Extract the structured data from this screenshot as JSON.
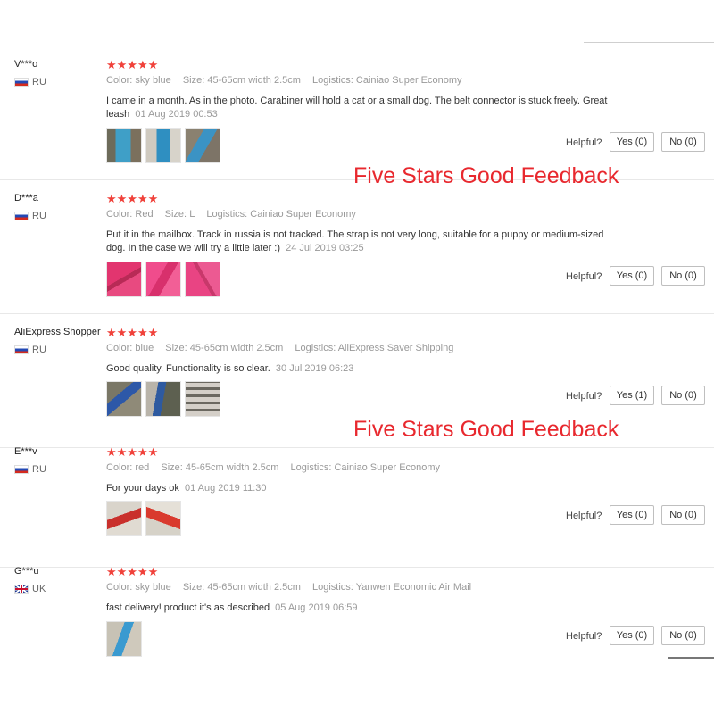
{
  "banner_text": "Five Stars Good Feedback",
  "helpful_label": "Helpful?",
  "reviews": [
    {
      "user": "V***o",
      "country": "RU",
      "stars": "★★★★★",
      "color_label": "Color:",
      "color": "sky blue",
      "size_label": "Size:",
      "size": "45-65cm width 2.5cm",
      "logistics_label": "Logistics:",
      "logistics": "Cainiao Super Economy",
      "text": "I came in a month. As in the photo. Carabiner will hold a cat or a small dog. The belt connector is stuck freely. Great leash",
      "date": "01 Aug 2019 00:53",
      "yes": "Yes (0)",
      "no": "No (0)"
    },
    {
      "user": "D***a",
      "country": "RU",
      "stars": "★★★★★",
      "color_label": "Color:",
      "color": "Red",
      "size_label": "Size:",
      "size": "L",
      "logistics_label": "Logistics:",
      "logistics": "Cainiao Super Economy",
      "text": "Put it in the mailbox. Track in russia is not tracked. The strap is not very long, suitable for a puppy or medium-sized dog. In the case we will try a little later :)",
      "date": "24 Jul 2019 03:25",
      "yes": "Yes (0)",
      "no": "No (0)"
    },
    {
      "user": "AliExpress Shopper",
      "country": "RU",
      "stars": "★★★★★",
      "color_label": "Color:",
      "color": "blue",
      "size_label": "Size:",
      "size": "45-65cm width 2.5cm",
      "logistics_label": "Logistics:",
      "logistics": "AliExpress Saver Shipping",
      "text": "Good quality. Functionality is so clear.",
      "date": "30 Jul 2019 06:23",
      "yes": "Yes (1)",
      "no": "No (0)"
    },
    {
      "user": "E***v",
      "country": "RU",
      "stars": "★★★★★",
      "color_label": "Color:",
      "color": "red",
      "size_label": "Size:",
      "size": "45-65cm width 2.5cm",
      "logistics_label": "Logistics:",
      "logistics": "Cainiao Super Economy",
      "text": "For your days ok",
      "date": "01 Aug 2019 11:30",
      "yes": "Yes (0)",
      "no": "No (0)"
    },
    {
      "user": "G***u",
      "country": "UK",
      "stars": "★★★★★",
      "color_label": "Color:",
      "color": "sky blue",
      "size_label": "Size:",
      "size": "45-65cm width 2.5cm",
      "logistics_label": "Logistics:",
      "logistics": "Yanwen Economic Air Mail",
      "text": "fast delivery! product it's as described",
      "date": "05 Aug 2019 06:59",
      "yes": "Yes (0)",
      "no": "No (0)"
    }
  ]
}
